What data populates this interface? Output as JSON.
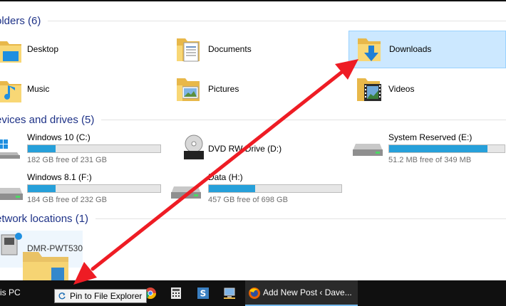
{
  "groups": {
    "folders": "olders (6)",
    "devices": "evices and drives (5)",
    "network": "etwork locations (1)"
  },
  "folders": [
    {
      "label": "Desktop",
      "icon": "desktop-folder-icon"
    },
    {
      "label": "Documents",
      "icon": "documents-folder-icon"
    },
    {
      "label": "Downloads",
      "icon": "downloads-folder-icon",
      "selected": true
    },
    {
      "label": "Music",
      "icon": "music-folder-icon"
    },
    {
      "label": "Pictures",
      "icon": "pictures-folder-icon"
    },
    {
      "label": "Videos",
      "icon": "videos-folder-icon"
    }
  ],
  "drives": [
    {
      "name": "Windows 10 (C:)",
      "free": "182 GB free of 231 GB",
      "used_fraction": 0.21
    },
    {
      "name": "DVD RW Drive (D:)"
    },
    {
      "name": "System Reserved (E:)",
      "free": "51.2 MB free of 349 MB",
      "used_fraction": 0.85
    },
    {
      "name": "Windows 8.1 (F:)",
      "free": "184 GB free of 232 GB",
      "used_fraction": 0.21
    },
    {
      "name": "Data (H:)",
      "free": "457 GB free of 698 GB",
      "used_fraction": 0.35
    }
  ],
  "network": {
    "label": "DMR-PWT530"
  },
  "taskbar": {
    "this_pc": "is PC",
    "active_window": "Add New Post ‹ Dave...",
    "tooltip": "Pin to File Explorer"
  },
  "colors": {
    "accent": "#26a0da",
    "selection": "#cce8ff",
    "header_text": "#1e3287",
    "arrow": "#ee1c24"
  }
}
